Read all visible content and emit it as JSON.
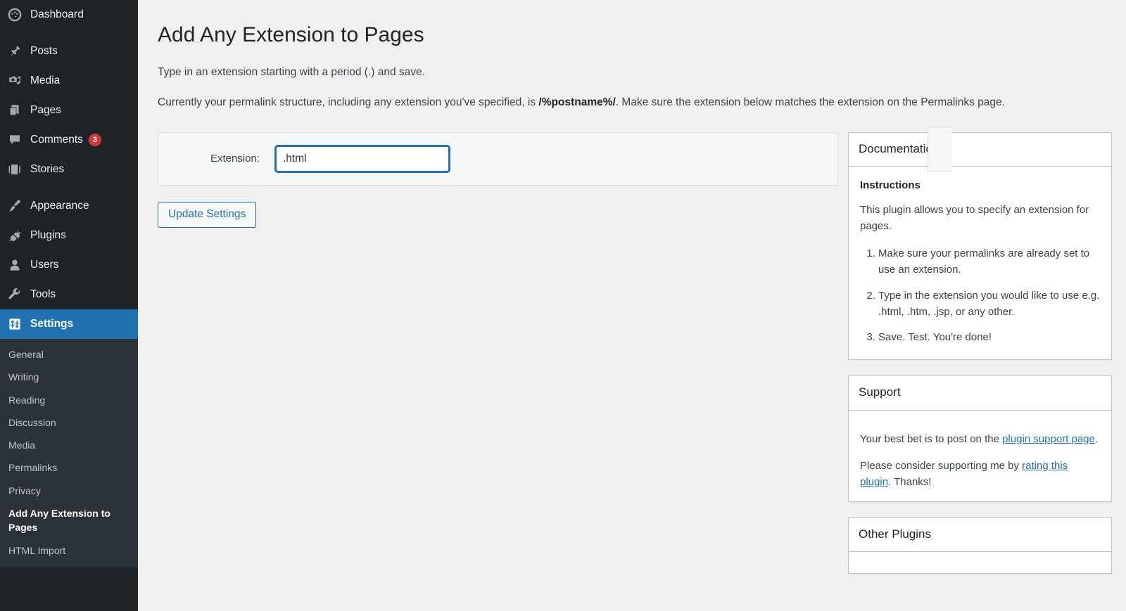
{
  "sidebar": {
    "items": [
      {
        "label": "Dashboard",
        "icon": "dashboard-icon",
        "name": "dashboard",
        "sep_after": true
      },
      {
        "label": "Posts",
        "icon": "pin-icon",
        "name": "posts"
      },
      {
        "label": "Media",
        "icon": "media-icon",
        "name": "media"
      },
      {
        "label": "Pages",
        "icon": "pages-icon",
        "name": "pages"
      },
      {
        "label": "Comments",
        "icon": "comment-icon",
        "name": "comments",
        "badge": "3"
      },
      {
        "label": "Stories",
        "icon": "stories-icon",
        "name": "stories",
        "sep_after": true
      },
      {
        "label": "Appearance",
        "icon": "brush-icon",
        "name": "appearance"
      },
      {
        "label": "Plugins",
        "icon": "plug-icon",
        "name": "plugins"
      },
      {
        "label": "Users",
        "icon": "user-icon",
        "name": "users"
      },
      {
        "label": "Tools",
        "icon": "wrench-icon",
        "name": "tools"
      },
      {
        "label": "Settings",
        "icon": "settings-icon",
        "name": "settings",
        "current": true
      }
    ],
    "submenu": [
      {
        "label": "General",
        "name": "general"
      },
      {
        "label": "Writing",
        "name": "writing"
      },
      {
        "label": "Reading",
        "name": "reading"
      },
      {
        "label": "Discussion",
        "name": "discussion"
      },
      {
        "label": "Media",
        "name": "media"
      },
      {
        "label": "Permalinks",
        "name": "permalinks"
      },
      {
        "label": "Privacy",
        "name": "privacy"
      },
      {
        "label": "Add Any Extension to Pages",
        "name": "add-any-extension-to-pages",
        "current": true
      },
      {
        "label": "HTML Import",
        "name": "html-import"
      }
    ],
    "accent_current": "#2271b1",
    "background": "#1d2327",
    "submenu_background": "#2c3338",
    "badge_color": "#d63638"
  },
  "page": {
    "title": "Add Any Extension to Pages",
    "desc1": "Type in an extension starting with a period (.) and save.",
    "desc2_before": "Currently your permalink structure, including any extension you've specified, is ",
    "desc2_bold": "/%postname%/",
    "desc2_after": ". Make sure the extension below matches the extension on the Permalinks page."
  },
  "form": {
    "extension_label": "Extension:",
    "extension_value": ".html",
    "extension_placeholder": ".html",
    "submit_label": "Update Settings"
  },
  "documentation": {
    "title": "Documentation",
    "heading": "Instructions",
    "intro": "This plugin allows you to specify an extension for pages.",
    "steps": [
      "Make sure your permalinks are already set to use an extension.",
      "Type in the extension you would like to use e.g. .html, .htm, .jsp, or any other.",
      "Save. Test. You're done!"
    ]
  },
  "support": {
    "title": "Support",
    "line1_before": "Your best bet is to post on the ",
    "line1_link": "plugin support page",
    "line1_after": ".",
    "line2_before": "Please consider supporting me by ",
    "line2_link": "rating this plugin",
    "line2_after": ". Thanks!"
  },
  "other_plugins": {
    "title": "Other Plugins"
  }
}
